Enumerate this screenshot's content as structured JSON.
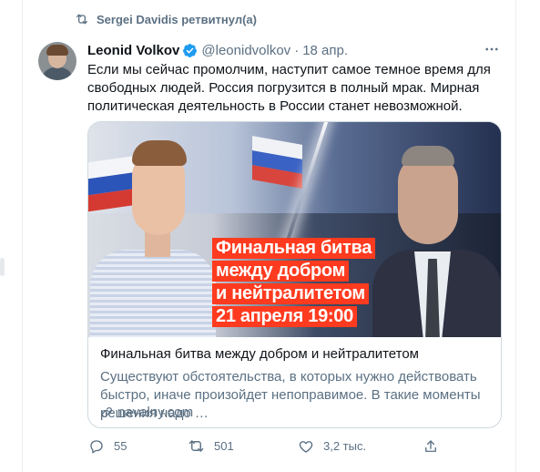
{
  "retweet": {
    "label": "Sergei Davidis ретвитнул(а)",
    "icon": "retweet-icon"
  },
  "author": {
    "name": "Leonid Volkov",
    "handle": "@leonidvolkov",
    "separator": "·",
    "date": "18 апр.",
    "verified": true
  },
  "tweet": {
    "text": "Если мы сейчас промолчим, наступит самое темное время для свободных людей. Россия погрузится в полный мрак. Мирная политическая деятельность в России станет невозможной."
  },
  "card": {
    "banner_lines": [
      "Финальная битва",
      "между добром",
      "и нейтралитетом",
      "21 апреля 19:00"
    ],
    "title": "Финальная битва между добром и нейтралитетом",
    "description": "Существуют обстоятельства, в которых нужно действовать быстро, иначе произойдет непоправимое. В такие моменты решения надо …",
    "domain": "navalny.com"
  },
  "actions": {
    "replies": "55",
    "retweets": "501",
    "likes": "3,2 тыс."
  },
  "colors": {
    "accent": "#1d9bf0",
    "secondary_text": "#5b7083",
    "banner_red": "#ff3b1f",
    "border": "#cfd9de"
  }
}
